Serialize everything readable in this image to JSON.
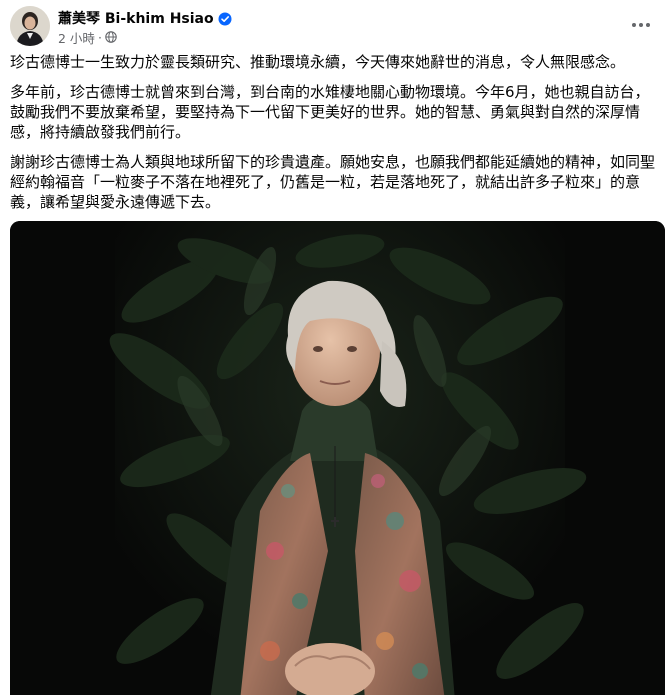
{
  "post": {
    "author": {
      "name": "蕭美琴 Bi-khim Hsiao",
      "verified_icon": "verified-badge-icon",
      "verified_color": "#0866ff"
    },
    "meta": {
      "time": "2 小時",
      "separator": "·",
      "audience_icon": "globe-icon"
    },
    "more_icon": "more-options-icon",
    "paragraphs": [
      "珍古德博士一生致力於靈長類研究、推動環境永續，今天傳來她辭世的消息，令人無限感念。",
      "多年前，珍古德博士就曾來到台灣，到台南的水雉棲地關心動物環境。今年6月，她也親自訪台，鼓勵我們不要放棄希望，要堅持為下一代留下更美好的世界。她的智慧、勇氣與對自然的深厚情感，將持續啟發我們前行。",
      "謝謝珍古德博士為人類與地球所留下的珍貴遺產。願她安息，也願我們都能延續她的精神，如同聖經約翰福音「一粒麥子不落在地裡死了，仍舊是一粒，若是落地死了，就結出許多子粒來」的意義，讓希望與愛永遠傳遞下去。"
    ],
    "photo_icon": "portrait-photo"
  },
  "colors": {
    "text": "#050505",
    "secondary_text": "#65676b",
    "photo_background": "#070807",
    "foliage": "#1c2a1b"
  }
}
